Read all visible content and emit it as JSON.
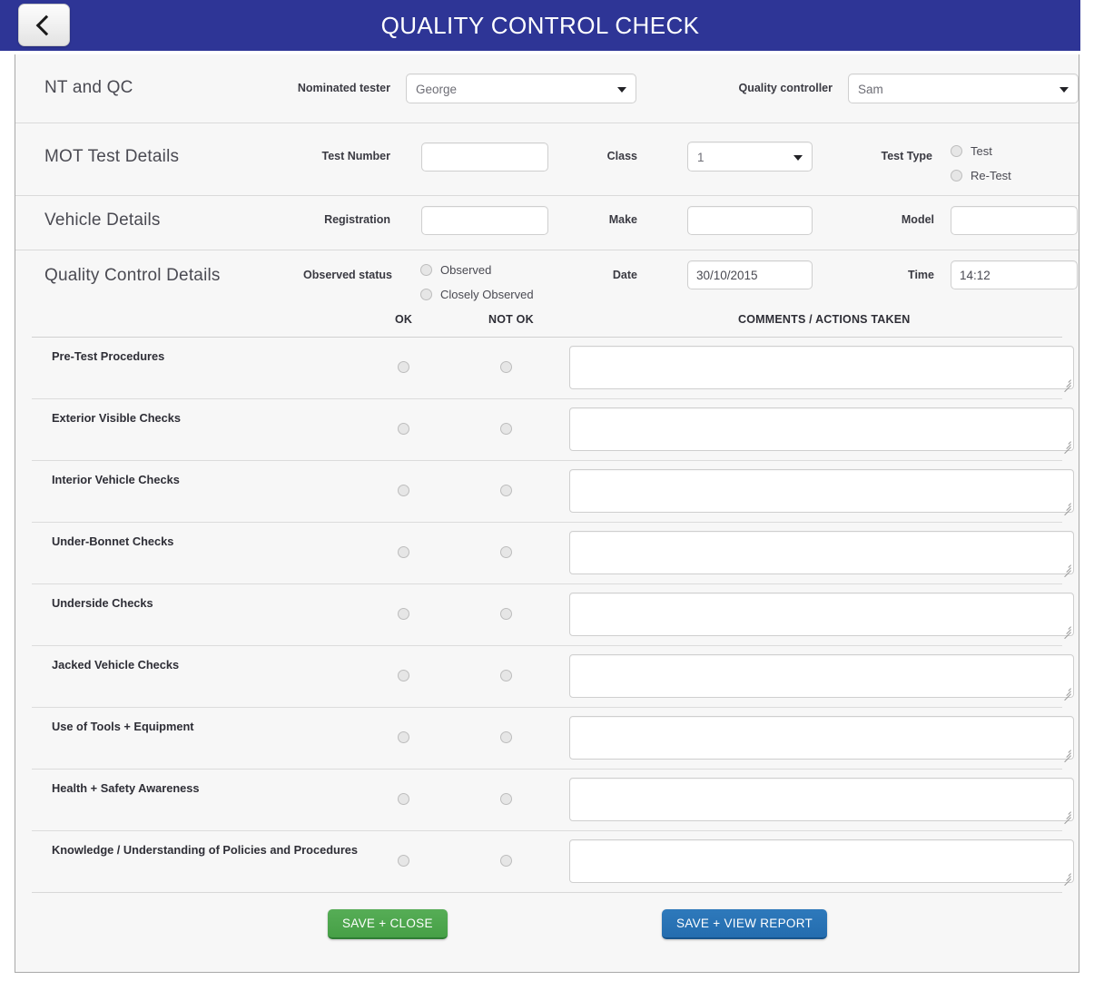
{
  "header": {
    "title": "QUALITY CONTROL CHECK",
    "back_label": "Back",
    "bar_color": "#2e3596"
  },
  "sections": {
    "nt_qc": {
      "title": "NT and QC",
      "nominated_tester": {
        "label": "Nominated tester",
        "value": "George"
      },
      "quality_controller": {
        "label": "Quality controller",
        "value": "Sam"
      }
    },
    "mot_test": {
      "title": "MOT Test Details",
      "test_number": {
        "label": "Test Number",
        "value": "",
        "placeholder": ""
      },
      "class": {
        "label": "Class",
        "value": "1"
      },
      "test_type": {
        "label": "Test Type",
        "options": [
          "Test",
          "Re-Test"
        ]
      }
    },
    "vehicle": {
      "title": "Vehicle Details",
      "registration": {
        "label": "Registration",
        "value": "",
        "placeholder": ""
      },
      "make": {
        "label": "Make",
        "value": "",
        "placeholder": ""
      },
      "model": {
        "label": "Model",
        "value": "",
        "placeholder": ""
      }
    },
    "qc_details": {
      "title": "Quality Control Details",
      "observed_status": {
        "label": "Observed status",
        "options": [
          "Observed",
          "Closely Observed"
        ]
      },
      "date": {
        "label": "Date",
        "value": "30/10/2015"
      },
      "time": {
        "label": "Time",
        "value": "14:12"
      }
    }
  },
  "checklist": {
    "columns": {
      "item": "",
      "ok": "OK",
      "not_ok": "NOT OK",
      "comments": "COMMENTS / ACTIONS TAKEN"
    },
    "rows": [
      {
        "label": "Pre-Test Procedures",
        "ok": false,
        "not_ok": false,
        "comment": ""
      },
      {
        "label": "Exterior Visible Checks",
        "ok": false,
        "not_ok": false,
        "comment": ""
      },
      {
        "label": "Interior Vehicle Checks",
        "ok": false,
        "not_ok": false,
        "comment": ""
      },
      {
        "label": "Under-Bonnet Checks",
        "ok": false,
        "not_ok": false,
        "comment": ""
      },
      {
        "label": "Underside Checks",
        "ok": false,
        "not_ok": false,
        "comment": ""
      },
      {
        "label": "Jacked Vehicle Checks",
        "ok": false,
        "not_ok": false,
        "comment": ""
      },
      {
        "label": "Use of Tools + Equipment",
        "ok": false,
        "not_ok": false,
        "comment": ""
      },
      {
        "label": "Health + Safety Awareness",
        "ok": false,
        "not_ok": false,
        "comment": ""
      },
      {
        "label": "Knowledge / Understanding of Policies and Procedures",
        "ok": false,
        "not_ok": false,
        "comment": ""
      }
    ]
  },
  "footer": {
    "save_close_label": "SAVE + CLOSE",
    "save_view_report_label": "SAVE + VIEW REPORT",
    "save_close_color": "#4ca64c",
    "save_view_report_color": "#2a72b5"
  }
}
